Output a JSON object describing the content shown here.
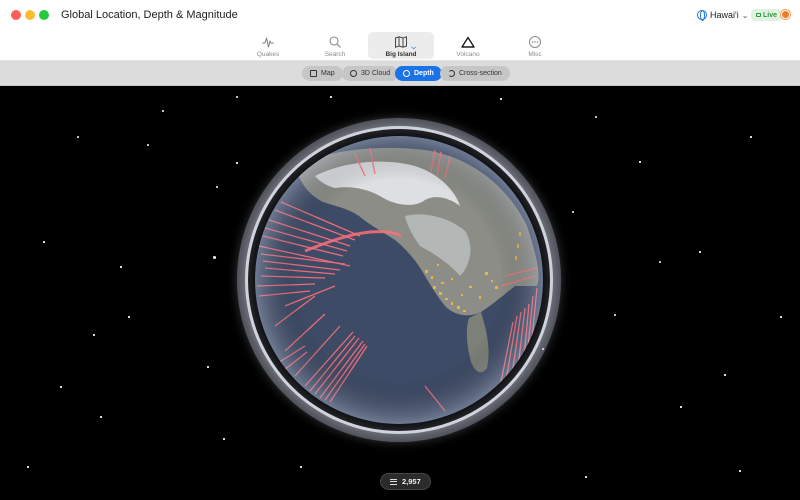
{
  "window": {
    "title": "Global Location, Depth & Magnitude"
  },
  "header": {
    "region": "Hawai'i",
    "region_icon": "globe-icon",
    "live_label": "Live",
    "status_icon": "sun-icon"
  },
  "toolbar": {
    "items": [
      {
        "label": "Quakes",
        "icon": "pulse-icon"
      },
      {
        "label": "Search",
        "icon": "search-icon"
      },
      {
        "label": "Big Island",
        "icon": "map-icon",
        "active": true
      },
      {
        "label": "Volcano",
        "icon": "volcano-icon"
      },
      {
        "label": "Misc",
        "icon": "more-icon"
      }
    ],
    "dropdown_glyph": "⌄"
  },
  "views": {
    "items": [
      {
        "label": "Map",
        "icon": "map-icon"
      },
      {
        "label": "3D Cloud",
        "icon": "cube-icon"
      },
      {
        "label": "Depth",
        "icon": "depth-icon",
        "active": true
      },
      {
        "label": "Cross-section",
        "icon": "cross-section-icon"
      }
    ]
  },
  "scene": {
    "event_count": "2,957",
    "count_icon": "list-icon",
    "colors": {
      "deep_events": "#ff6f7a",
      "shallow_events": "#f3b43e",
      "ocean": "#3d4a63"
    }
  }
}
